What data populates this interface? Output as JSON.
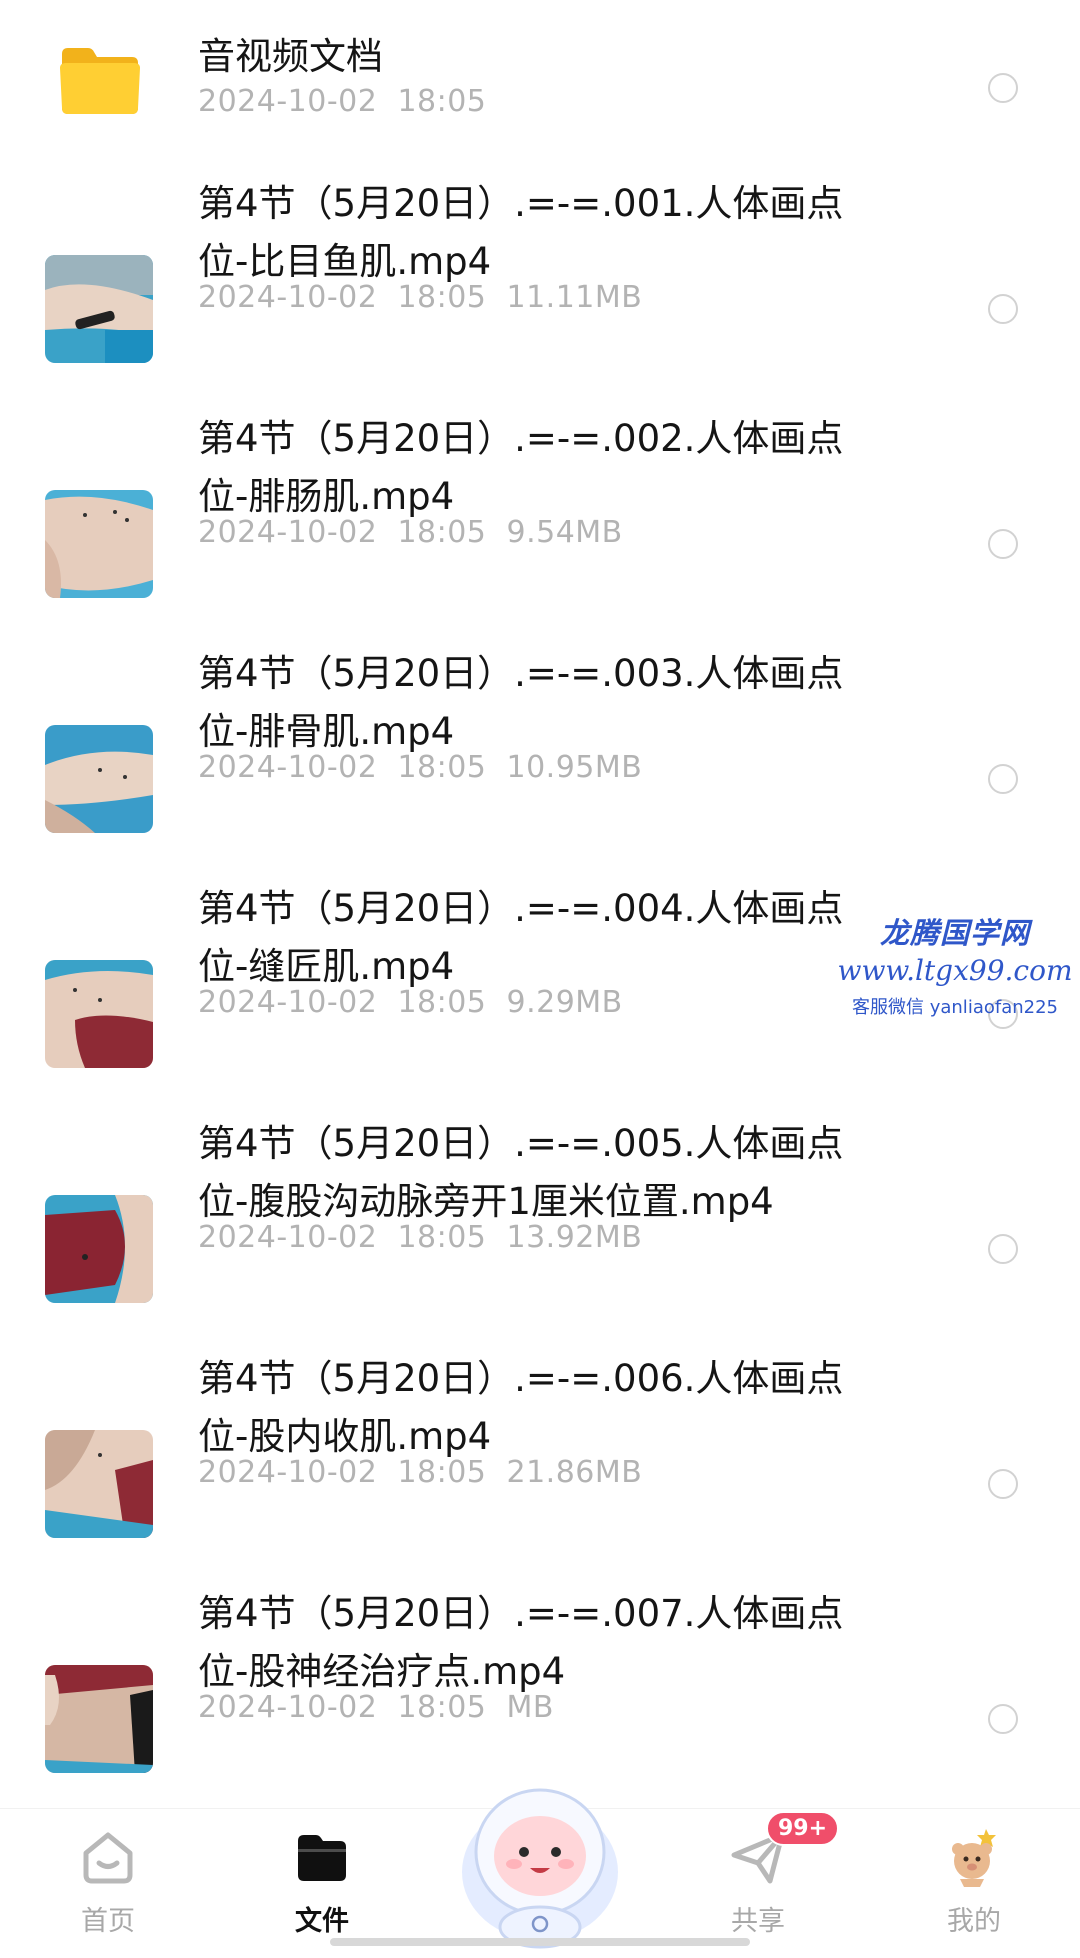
{
  "folder": {
    "name": "音视频文档",
    "date": "2024-10-02",
    "time": "18:05",
    "icon": "folder-icon",
    "color": "#ffc928"
  },
  "files": [
    {
      "name": "第4节（5月20日）.=-=.001.人体画点位-比目鱼肌.mp4",
      "date": "2024-10-02",
      "time": "18:05",
      "size": "11.11MB"
    },
    {
      "name": "第4节（5月20日）.=-=.002.人体画点位-腓肠肌.mp4",
      "date": "2024-10-02",
      "time": "18:05",
      "size": "9.54MB"
    },
    {
      "name": "第4节（5月20日）.=-=.003.人体画点位-腓骨肌.mp4",
      "date": "2024-10-02",
      "time": "18:05",
      "size": "10.95MB"
    },
    {
      "name": "第4节（5月20日）.=-=.004.人体画点位-缝匠肌.mp4",
      "date": "2024-10-02",
      "time": "18:05",
      "size": "9.29MB"
    },
    {
      "name": "第4节（5月20日）.=-=.005.人体画点位-腹股沟动脉旁开1厘米位置.mp4",
      "date": "2024-10-02",
      "time": "18:05",
      "size": "13.92MB"
    },
    {
      "name": "第4节（5月20日）.=-=.006.人体画点位-股内收肌.mp4",
      "date": "2024-10-02",
      "time": "18:05",
      "size": "21.86MB"
    },
    {
      "name": "第4节（5月20日）.=-=.007.人体画点位-股神经治疗点.mp4",
      "date": "2024-10-02",
      "time": "18:05",
      "size": "MB"
    }
  ],
  "watermark": {
    "title": "龙腾国学网",
    "url": "www.ltgx99.com",
    "contact": "客服微信 yanliaofan225"
  },
  "nav": {
    "home": {
      "label": "首页",
      "icon": "home-icon"
    },
    "files": {
      "label": "文件",
      "icon": "folder-icon"
    },
    "share": {
      "label": "共享",
      "icon": "paper-plane-icon",
      "badge": "99+"
    },
    "mine": {
      "label": "我的",
      "icon": "profile-avatar-icon"
    }
  },
  "colors": {
    "accent": "#111111",
    "badge": "#f04e6a",
    "folder": "#ffc928",
    "watermark": "#2f57c9"
  }
}
